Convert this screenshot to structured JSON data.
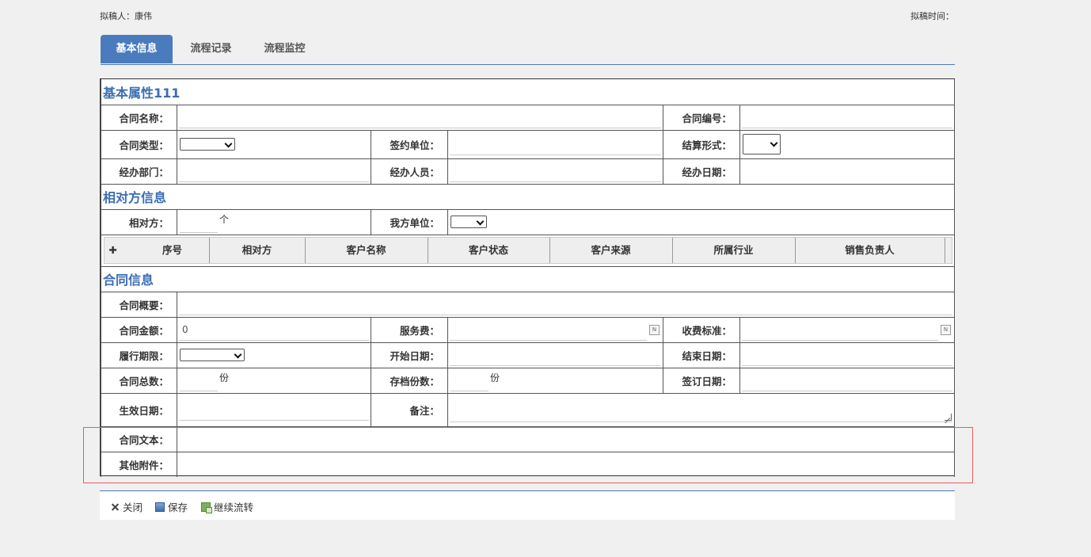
{
  "header": {
    "drafter_label": "拟稿人：",
    "drafter_name": "康伟",
    "draft_time_label": "拟稿时间："
  },
  "tabs": [
    {
      "label": "基本信息",
      "active": true
    },
    {
      "label": "流程记录",
      "active": false
    },
    {
      "label": "流程监控",
      "active": false
    }
  ],
  "sections": {
    "basic": {
      "title": "基本属性111",
      "contract_name": "合同名称：",
      "contract_no": "合同编号：",
      "contract_type": "合同类型：",
      "sign_unit": "签约单位：",
      "settle_form": "结算形式：",
      "handle_dept": "经办部门：",
      "handle_person": "经办人员：",
      "handle_date": "经办日期："
    },
    "counterparty": {
      "title": "相对方信息",
      "counterparty": "相对方：",
      "counterparty_unit": "个",
      "our_unit": "我方单位：",
      "columns": [
        "序号",
        "相对方",
        "客户名称",
        "客户状态",
        "客户来源",
        "所属行业",
        "销售负责人"
      ]
    },
    "contract": {
      "title": "合同信息",
      "summary": "合同概要：",
      "amount": "合同金额：",
      "amount_value": "0",
      "service_fee": "服务费：",
      "fee_standard": "收费标准：",
      "term": "履行期限：",
      "start_date": "开始日期：",
      "end_date": "结束日期：",
      "total_copies": "合同总数：",
      "copies_unit": "份",
      "archive_copies": "存档份数：",
      "archive_unit": "份",
      "sign_date": "签订日期：",
      "effective_date": "生效日期：",
      "remark": "备注：",
      "contract_text": "合同文本：",
      "other_attach": "其他附件："
    }
  },
  "toolbar": {
    "close": "关闭",
    "save": "保存",
    "continue": "继续流转"
  },
  "colors": {
    "accent": "#4a7bbd",
    "section_title": "#3a6db3",
    "highlight": "#e06060"
  }
}
